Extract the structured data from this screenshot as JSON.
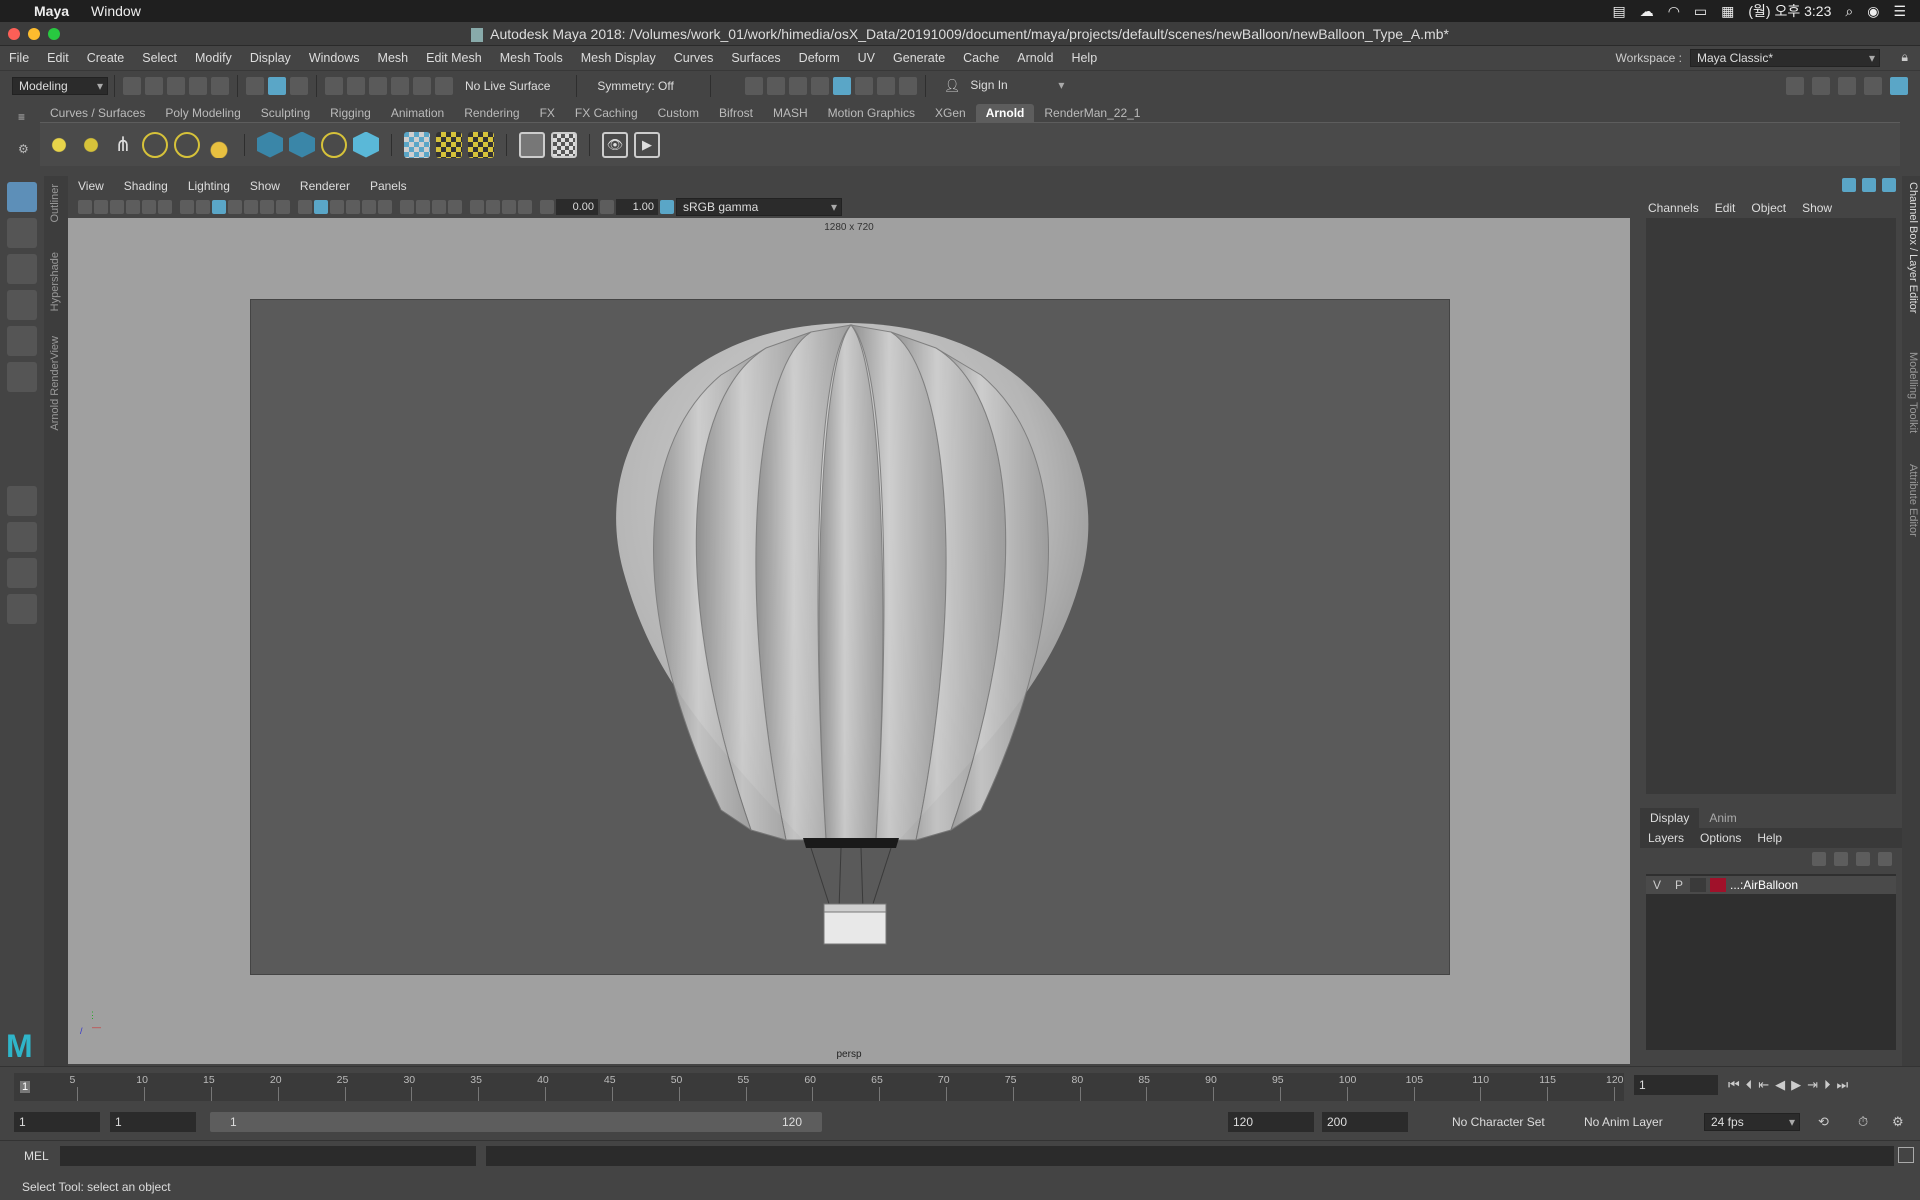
{
  "macos": {
    "app_name": "Maya",
    "menu_window": "Window",
    "clock": "(월) 오후 3:23"
  },
  "window": {
    "title": "Autodesk Maya 2018: /Volumes/work_01/work/himedia/osX_Data/20191009/document/maya/projects/default/scenes/newBalloon/newBalloon_Type_A.mb*"
  },
  "menus": [
    "File",
    "Edit",
    "Create",
    "Select",
    "Modify",
    "Display",
    "Windows",
    "Mesh",
    "Edit Mesh",
    "Mesh Tools",
    "Mesh Display",
    "Curves",
    "Surfaces",
    "Deform",
    "UV",
    "Generate",
    "Cache",
    "Arnold",
    "Help"
  ],
  "workspace": {
    "label": "Workspace :",
    "value": "Maya Classic*"
  },
  "statusline": {
    "menuset": "Modeling",
    "live_surface": "No Live Surface",
    "symmetry": "Symmetry: Off",
    "sign_in": "Sign In"
  },
  "shelf_tabs": [
    "Curves / Surfaces",
    "Poly Modeling",
    "Sculpting",
    "Rigging",
    "Animation",
    "Rendering",
    "FX",
    "FX Caching",
    "Custom",
    "Bifrost",
    "MASH",
    "Motion Graphics",
    "XGen",
    "Arnold",
    "RenderMan_22_1"
  ],
  "shelf_active": "Arnold",
  "side_tabs": [
    "Outliner",
    "Hypershade",
    "Arnold RenderView"
  ],
  "right_tabs": [
    "Channel Box / Layer Editor",
    "Modelling Toolkit",
    "Attribute Editor"
  ],
  "panel_menus": [
    "View",
    "Shading",
    "Lighting",
    "Show",
    "Renderer",
    "Panels"
  ],
  "panel_toolbar": {
    "exposure": "0.00",
    "gamma": "1.00",
    "color_space": "sRGB gamma"
  },
  "viewport": {
    "resolution": "1280 x 720",
    "camera": "persp"
  },
  "channel_box": {
    "menus": [
      "Channels",
      "Edit",
      "Object",
      "Show"
    ]
  },
  "layer_editor": {
    "tabs": [
      "Display",
      "Anim"
    ],
    "active_tab": "Display",
    "menus": [
      "Layers",
      "Options",
      "Help"
    ],
    "layer": {
      "v": "V",
      "p": "P",
      "name": "...:AirBalloon",
      "color": "#a0112a"
    }
  },
  "timeline": {
    "ticks": [
      "5",
      "10",
      "15",
      "20",
      "25",
      "30",
      "35",
      "40",
      "45",
      "50",
      "55",
      "60",
      "65",
      "70",
      "75",
      "80",
      "85",
      "90",
      "95",
      "100",
      "105",
      "110",
      "115",
      "120"
    ],
    "current_marker": "1",
    "current_frame": "1"
  },
  "range": {
    "start": "1",
    "playback_start": "1",
    "slider_start": "1",
    "slider_end": "120",
    "playback_end": "120",
    "end": "200",
    "character_set": "No Character Set",
    "anim_layer": "No Anim Layer",
    "fps": "24 fps"
  },
  "command": {
    "label": "MEL"
  },
  "help_line": "Select Tool: select an object",
  "colors": {
    "accent": "#5aa6c7",
    "shelf_yellow": "#d6c23a",
    "maya_logo": "#2fb5c9"
  }
}
